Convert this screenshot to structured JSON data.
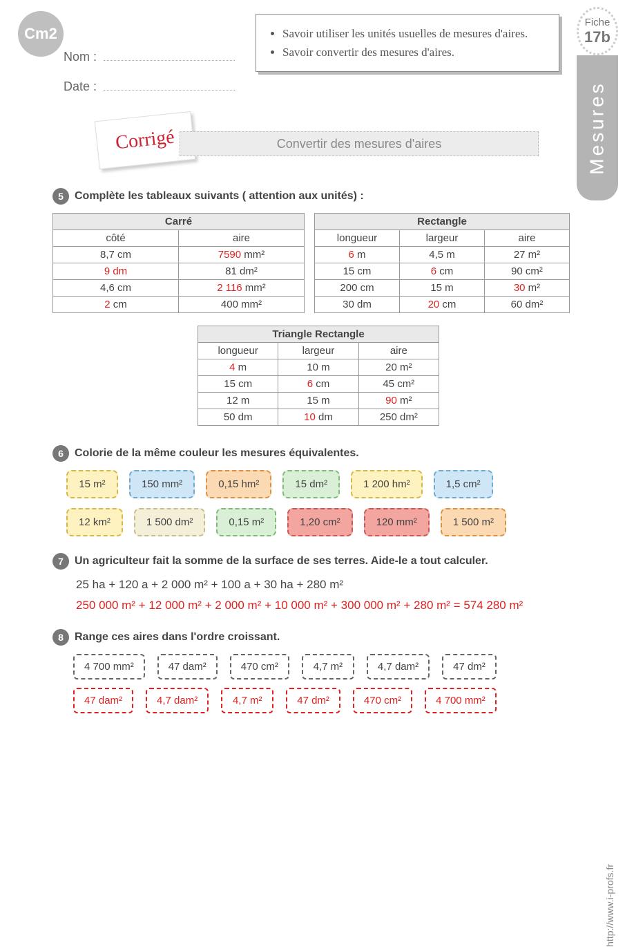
{
  "header": {
    "grade": "Cm2",
    "fiche_label": "Fiche",
    "fiche_number": "17b",
    "side_tab": "Mesures",
    "name_label": "Nom :",
    "date_label": "Date :",
    "objectives": [
      "Savoir utiliser les unités usuelles de mesures d'aires.",
      "Savoir convertir des mesures d'aires."
    ],
    "corrige": "Corrigé",
    "title": "Convertir des mesures d'aires"
  },
  "ex5": {
    "num": "5",
    "text": "Complète les tableaux suivants ( attention aux unités) :",
    "square_title": "Carré",
    "square_headers": [
      "côté",
      "aire"
    ],
    "square_rows": [
      {
        "cote": "8,7 cm",
        "aire_ans": "7590",
        "aire_unit": "  mm²"
      },
      {
        "cote_ans": "9 dm",
        "aire": "81 dm²"
      },
      {
        "cote": "4,6 cm",
        "aire_ans": "2 116",
        "aire_unit": "  mm²"
      },
      {
        "cote_ans": "2",
        "cote_unit": " cm",
        "aire": "400 mm²"
      }
    ],
    "rect_title": "Rectangle",
    "rect_headers": [
      "longueur",
      "largeur",
      "aire"
    ],
    "rect_rows": [
      {
        "L_ans": "6",
        "L_unit": "  m",
        "l": "4,5 m",
        "a": "27 m²"
      },
      {
        "L": "15 cm",
        "l_ans": "6",
        "l_unit": "   cm",
        "a": "90 cm²"
      },
      {
        "L": "200 cm",
        "l": "15 m",
        "a_ans": "30",
        "a_unit": "   m²"
      },
      {
        "L": "30 dm",
        "l_ans": "20",
        "l_unit": "   cm",
        "a": "60 dm²"
      }
    ],
    "tri_title": "Triangle Rectangle",
    "tri_headers": [
      "longueur",
      "largeur",
      "aire"
    ],
    "tri_rows": [
      {
        "L_ans": "4",
        "L_unit": "  m",
        "l": "10 m",
        "a": "20 m²"
      },
      {
        "L": "15 cm",
        "l_ans": "6",
        "l_unit": "   cm",
        "a": "45 cm²"
      },
      {
        "L": "12 m",
        "l": "15 m",
        "a_ans": "90",
        "a_unit": "   m²"
      },
      {
        "L": "50 dm",
        "l_ans": "10",
        "l_unit": " dm",
        "a": "250 dm²"
      }
    ]
  },
  "ex6": {
    "num": "6",
    "text": "Colorie de la même couleur les mesures équivalentes.",
    "row1": [
      {
        "v": "15 m²",
        "c": "yellow"
      },
      {
        "v": "150 mm²",
        "c": "blue"
      },
      {
        "v": "0,15 hm²",
        "c": "orange"
      },
      {
        "v": "15 dm²",
        "c": "mint"
      },
      {
        "v": "1 200 hm²",
        "c": "yellow"
      },
      {
        "v": "1,5 cm²",
        "c": "blue"
      }
    ],
    "row2": [
      {
        "v": "12 km²",
        "c": "yellow"
      },
      {
        "v": "1 500   dm²",
        "c": "beige"
      },
      {
        "v": "0,15 m²",
        "c": "mint"
      },
      {
        "v": "1,20 cm²",
        "c": "red"
      },
      {
        "v": "120 mm²",
        "c": "red"
      },
      {
        "v": "1 500 m²",
        "c": "orange"
      }
    ]
  },
  "ex7": {
    "num": "7",
    "text": "Un agriculteur fait la somme de la surface de ses terres. Aide-le a tout calculer.",
    "line1": "25 ha + 120 a + 2 000 m² + 100 a + 30 ha + 280 m²",
    "answer": "250 000 m² + 12 000 m² + 2 000 m² + 10 000 m² + 300 000 m² + 280 m² = 574 280 m²"
  },
  "ex8": {
    "num": "8",
    "text": "Range ces aires dans l'ordre croissant.",
    "given": [
      "4 700 mm²",
      "47 dam²",
      "470 cm²",
      "4,7 m²",
      "4,7 dam²",
      "47 dm²"
    ],
    "answer": [
      "47 dam²",
      "4,7 dam²",
      "4,7 m²",
      "47 dm²",
      "470 cm²",
      "4 700 mm²"
    ]
  },
  "site": "http://www.i-profs.fr"
}
